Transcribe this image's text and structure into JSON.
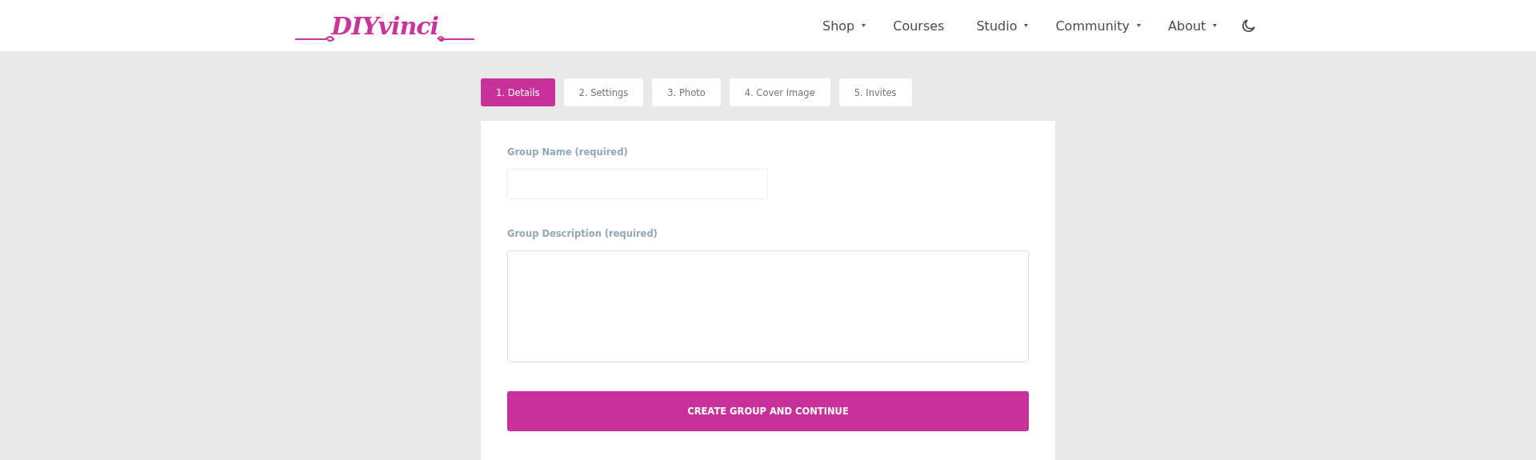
{
  "header": {
    "logo": "DIYvinci",
    "nav": [
      {
        "label": "Shop",
        "dropdown": true
      },
      {
        "label": "Courses",
        "dropdown": false
      },
      {
        "label": "Studio",
        "dropdown": true
      },
      {
        "label": "Community",
        "dropdown": true
      },
      {
        "label": "About",
        "dropdown": true
      }
    ]
  },
  "steps": [
    {
      "label": "1. Details",
      "selected": true
    },
    {
      "label": "2. Settings",
      "selected": false
    },
    {
      "label": "3. Photo",
      "selected": false
    },
    {
      "label": "4. Cover Image",
      "selected": false
    },
    {
      "label": "5. Invites",
      "selected": false
    }
  ],
  "form": {
    "fields": [
      {
        "kind": "input",
        "label": "Group Name (required)"
      },
      {
        "kind": "textarea",
        "label": "Group Description (required)"
      }
    ],
    "submit": "CREATE GROUP AND CONTINUE"
  }
}
